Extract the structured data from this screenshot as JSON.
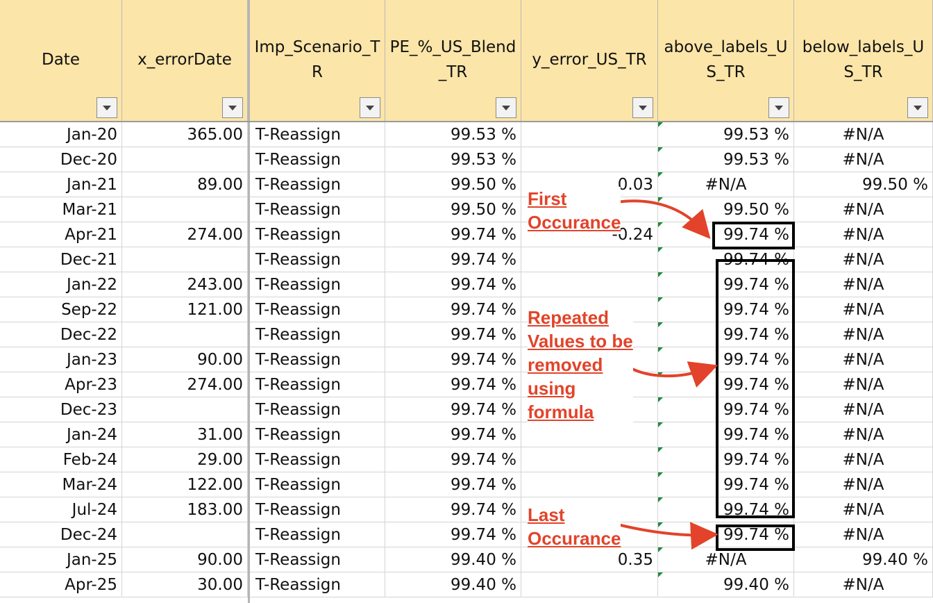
{
  "columns": [
    {
      "label": "Date"
    },
    {
      "label": "x_errorDate"
    },
    {
      "label": "Imp_Scenario_T\nR"
    },
    {
      "label": "PE_%_US_Blend\n_TR"
    },
    {
      "label": "y_error_US_TR"
    },
    {
      "label": "above_labels_U\nS_TR"
    },
    {
      "label": "below_labels_U\nS_TR"
    }
  ],
  "rows": [
    [
      "Jan-20",
      "365.00",
      "T-Reassign",
      "99.53 %",
      "",
      "99.53 %",
      "#N/A"
    ],
    [
      "Dec-20",
      "",
      "T-Reassign",
      "99.53 %",
      "",
      "99.53 %",
      "#N/A"
    ],
    [
      "Jan-21",
      "89.00",
      "T-Reassign",
      "99.50 %",
      "0.03",
      "#N/A",
      "99.50 %"
    ],
    [
      "Mar-21",
      "",
      "T-Reassign",
      "99.50 %",
      "",
      "99.50 %",
      "#N/A"
    ],
    [
      "Apr-21",
      "274.00",
      "T-Reassign",
      "99.74 %",
      "-0.24",
      "99.74 %",
      "#N/A"
    ],
    [
      "Dec-21",
      "",
      "T-Reassign",
      "99.74 %",
      "",
      "99.74 %",
      "#N/A"
    ],
    [
      "Jan-22",
      "243.00",
      "T-Reassign",
      "99.74 %",
      "",
      "99.74 %",
      "#N/A"
    ],
    [
      "Sep-22",
      "121.00",
      "T-Reassign",
      "99.74 %",
      "",
      "99.74 %",
      "#N/A"
    ],
    [
      "Dec-22",
      "",
      "T-Reassign",
      "99.74 %",
      "",
      "99.74 %",
      "#N/A"
    ],
    [
      "Jan-23",
      "90.00",
      "T-Reassign",
      "99.74 %",
      "",
      "99.74 %",
      "#N/A"
    ],
    [
      "Apr-23",
      "274.00",
      "T-Reassign",
      "99.74 %",
      "",
      "99.74 %",
      "#N/A"
    ],
    [
      "Dec-23",
      "",
      "T-Reassign",
      "99.74 %",
      "",
      "99.74 %",
      "#N/A"
    ],
    [
      "Jan-24",
      "31.00",
      "T-Reassign",
      "99.74 %",
      "",
      "99.74 %",
      "#N/A"
    ],
    [
      "Feb-24",
      "29.00",
      "T-Reassign",
      "99.74 %",
      "",
      "99.74 %",
      "#N/A"
    ],
    [
      "Mar-24",
      "122.00",
      "T-Reassign",
      "99.74 %",
      "",
      "99.74 %",
      "#N/A"
    ],
    [
      "Jul-24",
      "183.00",
      "T-Reassign",
      "99.74 %",
      "",
      "99.74 %",
      "#N/A"
    ],
    [
      "Dec-24",
      "",
      "T-Reassign",
      "99.74 %",
      "",
      "99.74 %",
      "#N/A"
    ],
    [
      "Jan-25",
      "90.00",
      "T-Reassign",
      "99.40 %",
      "0.35",
      "#N/A",
      "99.40 %"
    ],
    [
      "Apr-25",
      "30.00",
      "T-Reassign",
      "99.40 %",
      "",
      "99.40 %",
      "#N/A"
    ]
  ],
  "annotations": {
    "first": [
      "First",
      "Occurance"
    ],
    "repeated": [
      "Repeated",
      "Values to be",
      "removed",
      "using",
      "formula"
    ],
    "last": [
      "Last",
      "Occurance"
    ]
  },
  "colors": {
    "header_bg": "#fbe5a8",
    "annotation": "#e2432a",
    "error_indicator": "#1f8a3a"
  }
}
